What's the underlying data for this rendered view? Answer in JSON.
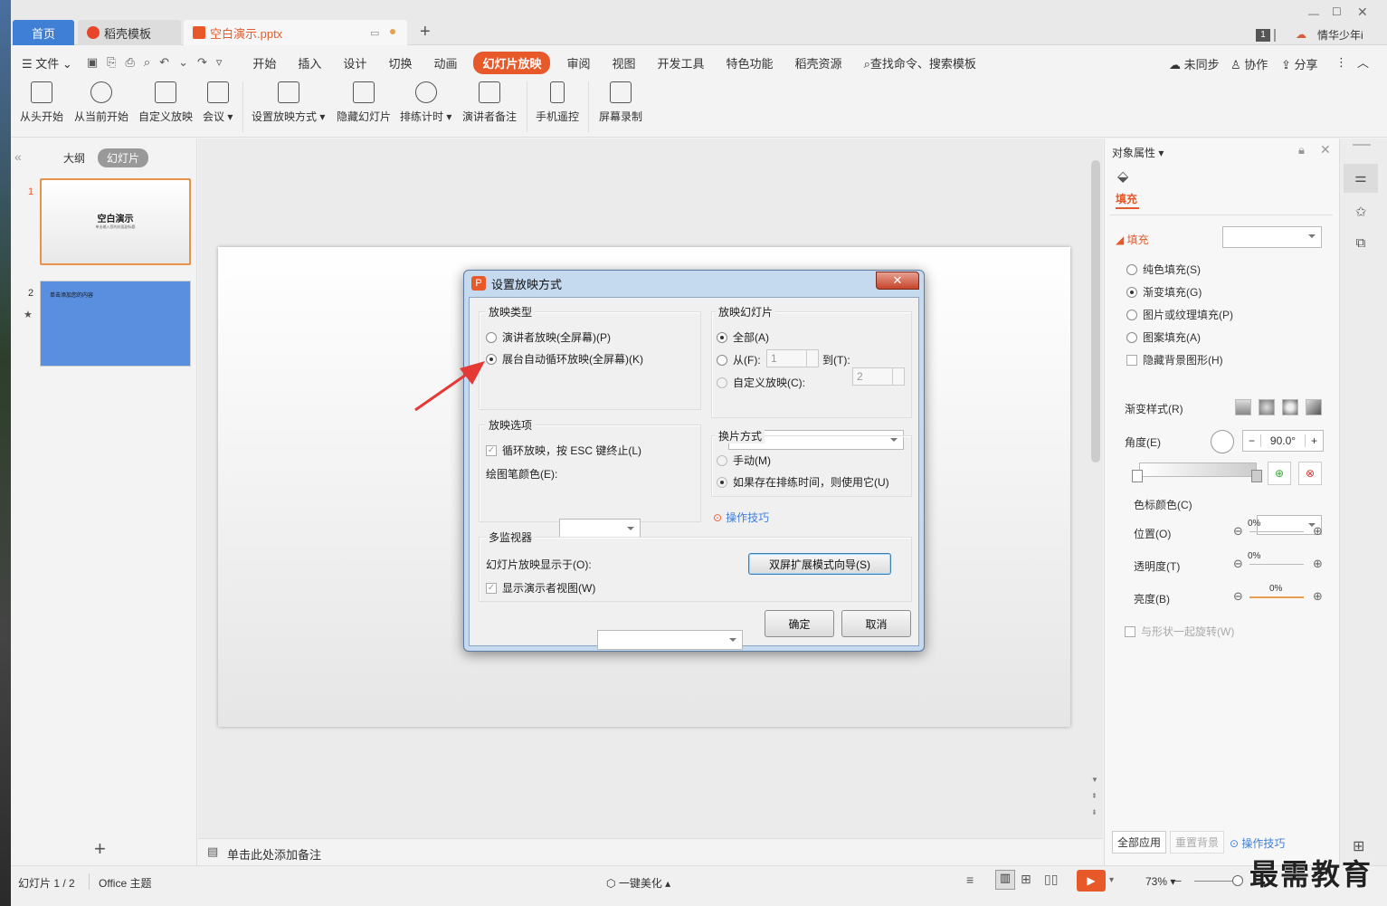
{
  "titlebar": {
    "tabs": [
      {
        "label": "首页"
      },
      {
        "label": "稻壳模板"
      },
      {
        "label": "空白演示.pptx"
      }
    ],
    "badge": "1",
    "user": "情华少年i"
  },
  "menu": {
    "file": "文件",
    "items": [
      "开始",
      "插入",
      "设计",
      "切换",
      "动画",
      "幻灯片放映",
      "审阅",
      "视图",
      "开发工具",
      "特色功能",
      "稻壳资源"
    ],
    "active": "幻灯片放映",
    "search": "查找命令、搜索模板",
    "sync": "未同步",
    "collab": "协作",
    "share": "分享"
  },
  "ribbon": {
    "buttons": [
      "从头开始",
      "从当前开始",
      "自定义放映",
      "会议",
      "设置放映方式",
      "隐藏幻灯片",
      "排练计时",
      "演讲者备注",
      "手机遥控",
      "屏幕录制"
    ]
  },
  "leftpanel": {
    "tab_outline": "大纲",
    "tab_slides": "幻灯片",
    "slides": [
      {
        "num": "1",
        "title": "空白演示",
        "sub": "单击输入您的封面副标题"
      },
      {
        "num": "2",
        "title": "单击添加您的内容"
      }
    ]
  },
  "notes": {
    "placeholder": "单击此处添加备注"
  },
  "dialog": {
    "title": "设置放映方式",
    "show_type": {
      "label": "放映类型",
      "opt1": "演讲者放映(全屏幕)(P)",
      "opt2": "展台自动循环放映(全屏幕)(K)"
    },
    "slides": {
      "label": "放映幻灯片",
      "all": "全部(A)",
      "from": "从(F):",
      "from_val": "1",
      "to": "到(T):",
      "to_val": "2",
      "custom": "自定义放映(C):"
    },
    "options": {
      "label": "放映选项",
      "loop": "循环放映，按 ESC 键终止(L)",
      "pen": "绘图笔颜色(E):"
    },
    "advance": {
      "label": "换片方式",
      "manual": "手动(M)",
      "timing": "如果存在排练时间，则使用它(U)"
    },
    "tips": "操作技巧",
    "monitor": {
      "label": "多监视器",
      "show_on": "幻灯片放映显示于(O):",
      "wizard": "双屏扩展模式向导(S)",
      "presenter": "显示演示者视图(W)"
    },
    "ok": "确定",
    "cancel": "取消"
  },
  "rightpanel": {
    "title": "对象属性",
    "tab": "填充",
    "fill_label": "填充",
    "fills": [
      "纯色填充(S)",
      "渐变填充(G)",
      "图片或纹理填充(P)",
      "图案填充(A)"
    ],
    "hide_bg": "隐藏背景图形(H)",
    "grad_style": "渐变样式(R)",
    "angle": "角度(E)",
    "angle_val": "90.0°",
    "stop_color": "色标颜色(C)",
    "position": "位置(O)",
    "position_val": "0%",
    "transparency": "透明度(T)",
    "transparency_val": "0%",
    "brightness": "亮度(B)",
    "brightness_val": "0%",
    "rotate": "与形状一起旋转(W)",
    "apply_all": "全部应用",
    "reset_bg": "重置背景",
    "tips": "操作技巧"
  },
  "status": {
    "slide": "幻灯片 1 / 2",
    "theme": "Office 主题",
    "beautify": "一键美化",
    "zoom": "73%"
  },
  "watermark": "最需教育",
  "colors": {
    "accent": "#e8592a",
    "blue": "#3f7fd6",
    "slide2": "#5a8fe0"
  }
}
